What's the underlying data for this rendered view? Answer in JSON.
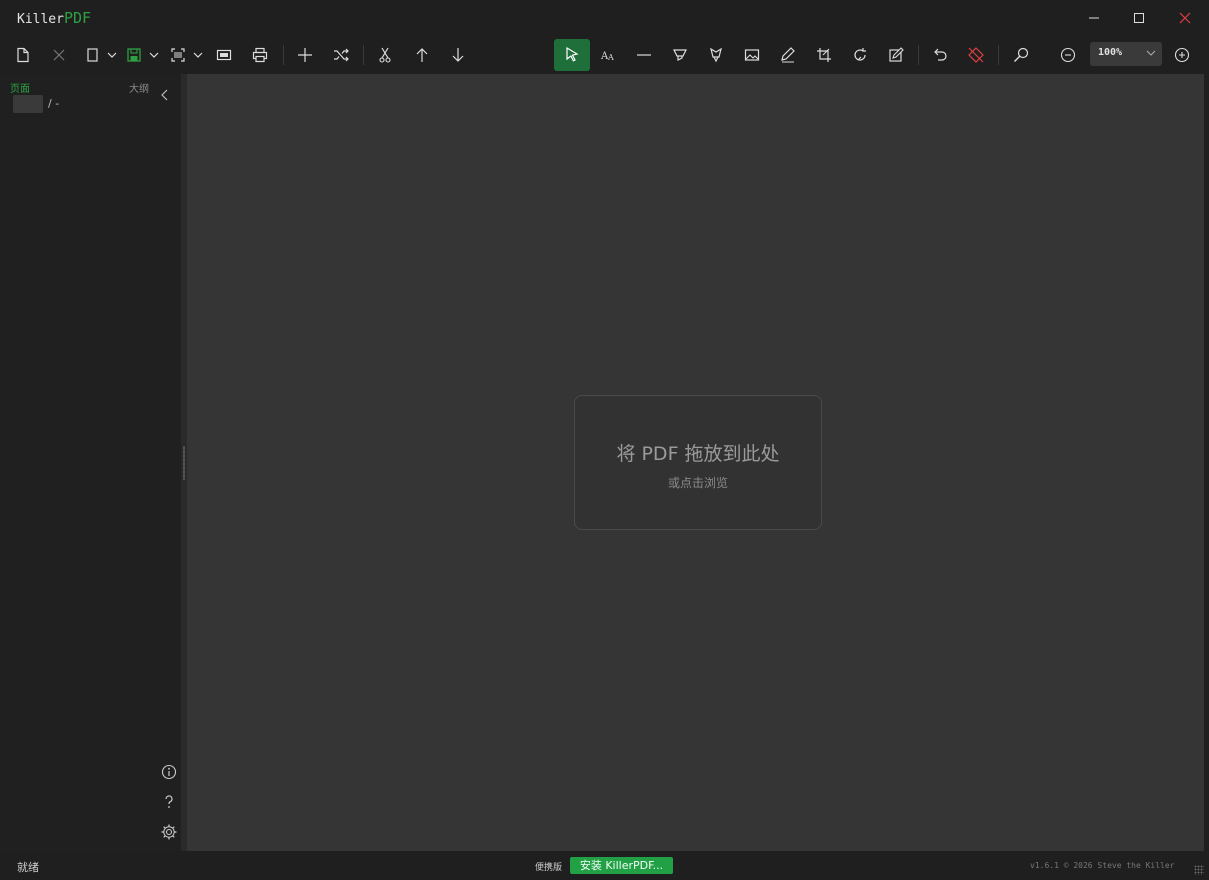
{
  "app": {
    "title_prefix": "Killer",
    "title_accent": "PDF"
  },
  "toolbar": {
    "zoom_value": "100%",
    "icons": [
      "new-file-icon",
      "close-file-icon",
      "page-size-icon",
      "save-icon",
      "scan-icon",
      "screen-icon",
      "print-icon",
      "add-icon",
      "shuffle-icon",
      "cut-icon",
      "move-up-icon",
      "move-down-icon",
      "select-pointer-icon",
      "text-icon",
      "line-icon",
      "highlight-icon",
      "marker-icon",
      "image-icon",
      "signature-icon",
      "crop-icon",
      "rotate-icon",
      "edit-icon",
      "undo-icon",
      "clear-annotations-icon",
      "search-icon",
      "zoom-out-icon",
      "zoom-in-icon"
    ]
  },
  "sidebar": {
    "tab_pages": "页面",
    "tab_outline": "大纲",
    "page_total": "/ -"
  },
  "canvas": {
    "drop_title": "将 PDF 拖放到此处",
    "drop_subtitle": "或点击浏览"
  },
  "status": {
    "text": "就绪",
    "portable_label": "便携版",
    "install_button": "安装 KillerPDF...",
    "copyright": "v1.6.1  © 2026  Steve the Killer"
  },
  "colors": {
    "accent": "#2ea043",
    "canvas_bg": "#353535",
    "window_bg": "#1f1f1f",
    "close_red": "#e04040"
  }
}
